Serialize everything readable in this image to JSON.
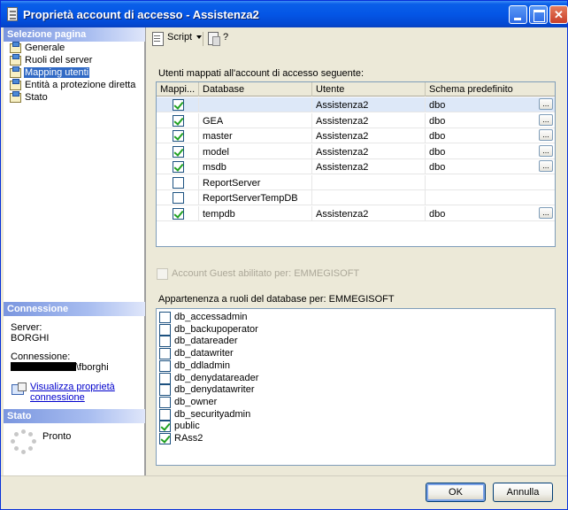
{
  "window": {
    "title": "Proprietà account di accesso - Assistenza2"
  },
  "left": {
    "select_page_header": "Selezione pagina",
    "pages": [
      {
        "label": "Generale"
      },
      {
        "label": "Ruoli del server"
      },
      {
        "label": "Mapping utenti",
        "selected": true
      },
      {
        "label": "Entità a protezione diretta"
      },
      {
        "label": "Stato"
      }
    ],
    "connection_header": "Connessione",
    "server_label": "Server:",
    "server_value": "BORGHI",
    "connection_label": "Connessione:",
    "connection_value": "\\fborghi",
    "view_props_line1": "Visualizza proprietà",
    "view_props_line2": "connessione",
    "status_header": "Stato",
    "status_value": "Pronto"
  },
  "toolbar": {
    "script_label": "Script",
    "help_label": "?"
  },
  "mapping": {
    "label": "Utenti mappati all'account di accesso seguente:",
    "columns": [
      "Mappi...",
      "Database",
      "Utente",
      "Schema predefinito"
    ],
    "rows": [
      {
        "mapped": true,
        "database": "",
        "user": "Assistenza2",
        "schema": "dbo",
        "ellipsis": "...",
        "selected": true
      },
      {
        "mapped": true,
        "database": "GEA",
        "user": "Assistenza2",
        "schema": "dbo",
        "ellipsis": "..."
      },
      {
        "mapped": true,
        "database": "master",
        "user": "Assistenza2",
        "schema": "dbo",
        "ellipsis": "..."
      },
      {
        "mapped": true,
        "database": "model",
        "user": "Assistenza2",
        "schema": "dbo",
        "ellipsis": "..."
      },
      {
        "mapped": true,
        "database": "msdb",
        "user": "Assistenza2",
        "schema": "dbo",
        "ellipsis": "..."
      },
      {
        "mapped": false,
        "database": "ReportServer",
        "user": "",
        "schema": "",
        "ellipsis": ""
      },
      {
        "mapped": false,
        "database": "ReportServerTempDB",
        "user": "",
        "schema": "",
        "ellipsis": ""
      },
      {
        "mapped": true,
        "database": "tempdb",
        "user": "Assistenza2",
        "schema": "dbo",
        "ellipsis": "..."
      }
    ]
  },
  "guest": {
    "label": "Account Guest abilitato per: EMMEGISOFT",
    "checked": false,
    "disabled": true
  },
  "roles": {
    "label": "Appartenenza a ruoli del database per: EMMEGISOFT",
    "items": [
      {
        "name": "db_accessadmin",
        "checked": false
      },
      {
        "name": "db_backupoperator",
        "checked": false
      },
      {
        "name": "db_datareader",
        "checked": false
      },
      {
        "name": "db_datawriter",
        "checked": false
      },
      {
        "name": "db_ddladmin",
        "checked": false
      },
      {
        "name": "db_denydatareader",
        "checked": false
      },
      {
        "name": "db_denydatawriter",
        "checked": false
      },
      {
        "name": "db_owner",
        "checked": false
      },
      {
        "name": "db_securityadmin",
        "checked": false
      },
      {
        "name": "public",
        "checked": true
      },
      {
        "name": "RAss2",
        "checked": true
      }
    ]
  },
  "buttons": {
    "ok": "OK",
    "cancel": "Annulla"
  }
}
